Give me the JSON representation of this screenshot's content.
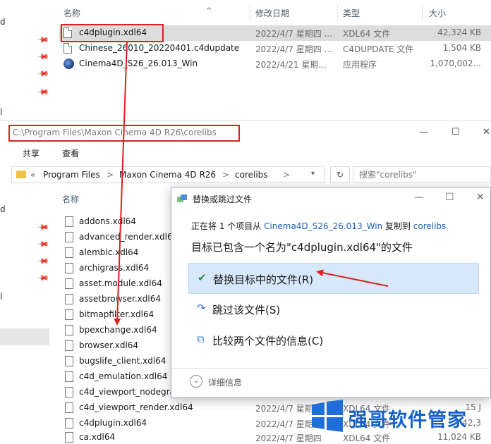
{
  "source_pane": {
    "columns": {
      "name": "名称",
      "date": "修改日期",
      "type": "类型",
      "size": "大小"
    },
    "nav_chars": [
      "d",
      "l"
    ],
    "files": [
      {
        "name": "c4dplugin.xdl64",
        "date": "2022/4/7 星期四 ...",
        "type": "XDL64 文件",
        "size": "42,324 KB",
        "icon": "file-icon"
      },
      {
        "name": "Chinese_26010_20220401.c4dupdate",
        "date": "2022/4/7 星期四 ...",
        "type": "C4DUPDATE 文件",
        "size": "1,504 KB",
        "icon": "file-icon"
      },
      {
        "name": "Cinema4D_S26_26.013_Win",
        "date": "2022/4/21 星期...",
        "type": "应用程序",
        "size": "1,070,002...",
        "icon": "cinema4d-icon"
      }
    ]
  },
  "dest_window": {
    "path_title": "C:\\Program Files\\Maxon Cinema 4D R26\\corelibs",
    "ribbon": {
      "share": "共享",
      "view": "查看"
    },
    "breadcrumbs": [
      "«",
      "Program Files",
      ">",
      "Maxon Cinema 4D R26",
      ">",
      "corelibs",
      ">"
    ],
    "search_placeholder": "搜索\"corelibs\"",
    "name_column": "名称",
    "nav_chars": [
      "d",
      "l"
    ],
    "files": [
      {
        "name": "addons.xdl64"
      },
      {
        "name": "advanced_render.xdl64"
      },
      {
        "name": "alembic.xdl64"
      },
      {
        "name": "archigrass.xdl64"
      },
      {
        "name": "asset.module.xdl64"
      },
      {
        "name": "assetbrowser.xdl64"
      },
      {
        "name": "bitmapfilter.xdl64"
      },
      {
        "name": "bpexchange.xdl64"
      },
      {
        "name": "browser.xdl64"
      },
      {
        "name": "bugslife_client.xdl64"
      },
      {
        "name": "c4d_emulation.xdl64"
      },
      {
        "name": "c4d_viewport_nodegra"
      },
      {
        "name": "c4d_viewport_render.xdl64",
        "date": "2022/4/7 星期四",
        "type": "XDL64 文件",
        "size": "15 J"
      },
      {
        "name": "c4dplugin.xdl64",
        "date": "2022/4/7 星期四",
        "type": "XDL64 文件",
        "size": "42,3"
      },
      {
        "name": "ca.xdl64",
        "date": "2022/4/7 星期四",
        "type": "XDL64 文件",
        "size": "11,024 KB"
      }
    ]
  },
  "dialog": {
    "title": "替换或跳过文件",
    "line1_prefix": "正在将 1 个项目从 ",
    "line1_source": "Cinema4D_S26_26.013_Win",
    "line1_middle": " 复制到 ",
    "line1_dest": "corelibs",
    "headline": "目标已包含一个名为\"c4dplugin.xdl64\"的文件",
    "options": [
      {
        "label": "替换目标中的文件(R)",
        "icon": "checkmark-icon"
      },
      {
        "label": "跳过该文件(S)",
        "icon": "skip-icon"
      },
      {
        "label": "比较两个文件的信息(C)",
        "icon": "compare-icon"
      }
    ],
    "more_info": "详细信息"
  },
  "watermark": {
    "text": "强哥软件管家"
  },
  "colors": {
    "highlight_red": "#e02020",
    "link_blue": "#1a5fb4",
    "option_active_bg": "#d6e8fa",
    "watermark_blue": "#1560c9"
  }
}
